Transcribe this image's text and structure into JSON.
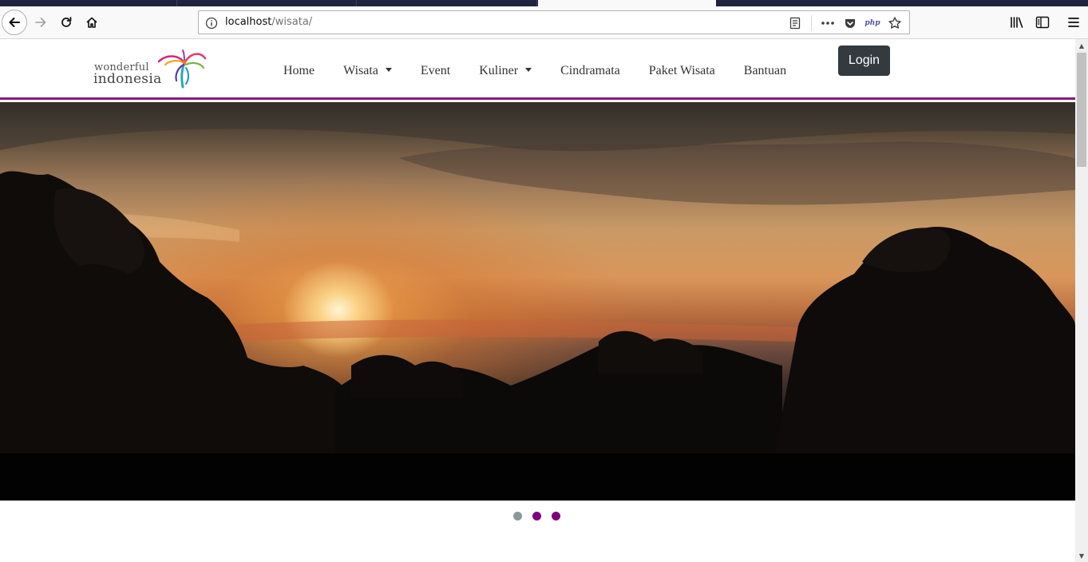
{
  "browser": {
    "url_host": "localhost",
    "url_path": "/wisata/",
    "php_label": "php"
  },
  "site": {
    "logo": {
      "line1": "wonderful",
      "line2": "indonesia"
    },
    "menu": [
      {
        "label": "Home",
        "dropdown": false
      },
      {
        "label": "Wisata",
        "dropdown": true
      },
      {
        "label": "Event",
        "dropdown": false
      },
      {
        "label": "Kuliner",
        "dropdown": true
      },
      {
        "label": "Cindramata",
        "dropdown": false
      },
      {
        "label": "Paket Wisata",
        "dropdown": false
      },
      {
        "label": "Bantuan",
        "dropdown": false
      }
    ],
    "login_label": "Login"
  },
  "carousel": {
    "slide_count": 3,
    "active_index": 0,
    "active_color": "#8c979b",
    "inactive_color": "#800080"
  },
  "colors": {
    "accent_line": "#8a1a7e",
    "login_bg": "#343a40"
  }
}
